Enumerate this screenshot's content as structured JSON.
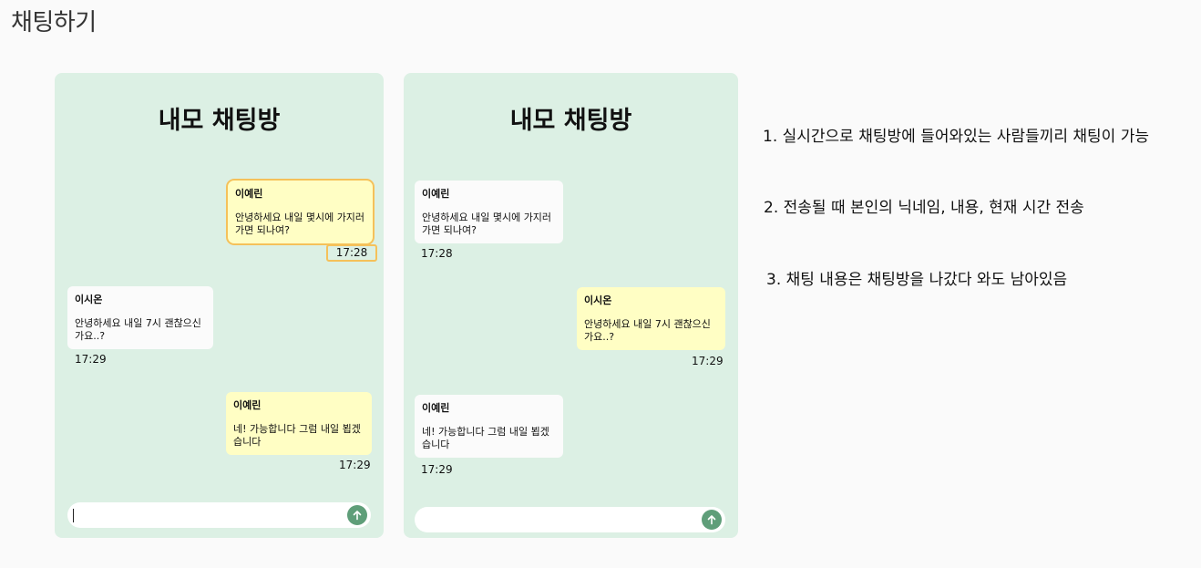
{
  "page": {
    "title": "채팅하기"
  },
  "phones": [
    {
      "room_title": "내모 채팅방",
      "messages": [
        {
          "nick": "이예린",
          "text": "안녕하세요 내일 몇시에 가지러 가면 되나여?",
          "time": "17:28"
        },
        {
          "nick": "이시온",
          "text": "안녕하세요 내일 7시 괜찮으신가요..?",
          "time": "17:29"
        },
        {
          "nick": "이예린",
          "text": "네! 가능합니다 그럼 내일 뵙겠습니다",
          "time": "17:29"
        }
      ],
      "input": {
        "value": ""
      }
    },
    {
      "room_title": "내모 채팅방",
      "messages": [
        {
          "nick": "이예린",
          "text": "안녕하세요 내일 몇시에 가지러 가면 되나여?",
          "time": "17:28"
        },
        {
          "nick": "이시온",
          "text": "안녕하세요 내일 7시 괜찮으신가요..?",
          "time": "17:29"
        },
        {
          "nick": "이예린",
          "text": "네! 가능합니다 그럼 내일 뵙겠습니다",
          "time": "17:29"
        }
      ],
      "input": {
        "value": ""
      }
    }
  ],
  "notes": [
    "1. 실시간으로 채팅방에 들어와있는 사람들끼리 채팅이 가능",
    "2. 전송될 때 본인의 닉네임, 내용, 현재 시간 전송",
    "3. 채팅 내용은 채팅방을 나갔다 와도 남아있음"
  ],
  "icons": {
    "send": "arrow-up-icon"
  },
  "colors": {
    "background": "#fafafa",
    "chat_bg": "#dcf0e4",
    "my_bubble": "#fffec4",
    "other_bubble": "#fbfbfb",
    "highlight": "#f5c15a",
    "send_button": "#5f9e79"
  }
}
